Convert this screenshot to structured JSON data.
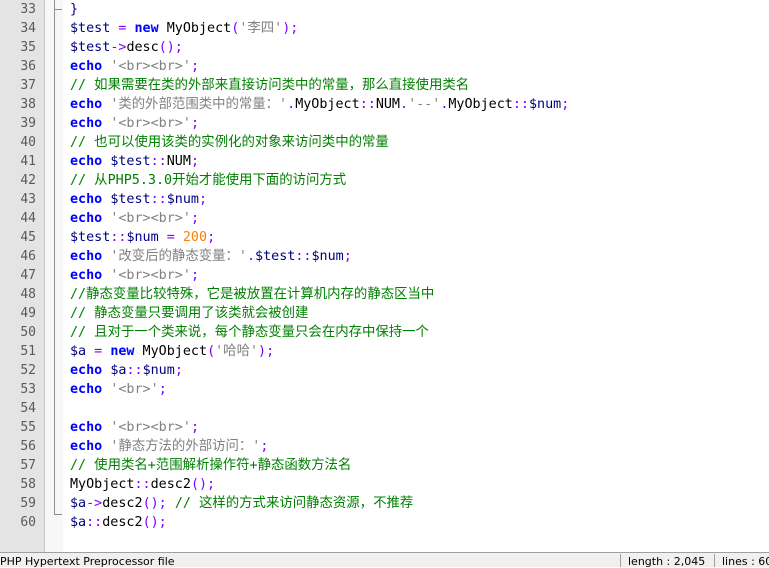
{
  "editor": {
    "lines": [
      {
        "num": "33",
        "tokens": [
          {
            "t": "fold",
            "v": "}"
          }
        ]
      },
      {
        "num": "34",
        "tokens": [
          {
            "t": "var",
            "v": "$test"
          },
          {
            "t": "op",
            "v": " = "
          },
          {
            "t": "keyword",
            "v": "new"
          },
          {
            "t": "plain",
            "v": " MyObject"
          },
          {
            "t": "op",
            "v": "("
          },
          {
            "t": "str",
            "v": "'李四'"
          },
          {
            "t": "op",
            "v": ");"
          }
        ]
      },
      {
        "num": "35",
        "tokens": [
          {
            "t": "var",
            "v": "$test"
          },
          {
            "t": "op",
            "v": "->"
          },
          {
            "t": "plain",
            "v": "desc"
          },
          {
            "t": "op",
            "v": "();"
          }
        ]
      },
      {
        "num": "36",
        "tokens": [
          {
            "t": "keyword",
            "v": "echo"
          },
          {
            "t": "plain",
            "v": " "
          },
          {
            "t": "str",
            "v": "'<br><br>'"
          },
          {
            "t": "op",
            "v": ";"
          }
        ]
      },
      {
        "num": "37",
        "tokens": [
          {
            "t": "comment",
            "v": "// 如果需要在类的外部来直接访问类中的常量，那么直接使用类名"
          }
        ]
      },
      {
        "num": "38",
        "tokens": [
          {
            "t": "keyword",
            "v": "echo"
          },
          {
            "t": "plain",
            "v": " "
          },
          {
            "t": "str",
            "v": "'类的外部范围类中的常量：'"
          },
          {
            "t": "op",
            "v": "."
          },
          {
            "t": "plain",
            "v": "MyObject"
          },
          {
            "t": "op",
            "v": "::"
          },
          {
            "t": "plain",
            "v": "NUM"
          },
          {
            "t": "op",
            "v": "."
          },
          {
            "t": "str",
            "v": "'--'"
          },
          {
            "t": "op",
            "v": "."
          },
          {
            "t": "plain",
            "v": "MyObject"
          },
          {
            "t": "op",
            "v": "::"
          },
          {
            "t": "var",
            "v": "$num"
          },
          {
            "t": "op",
            "v": ";"
          }
        ]
      },
      {
        "num": "39",
        "tokens": [
          {
            "t": "keyword",
            "v": "echo"
          },
          {
            "t": "plain",
            "v": " "
          },
          {
            "t": "str",
            "v": "'<br><br>'"
          },
          {
            "t": "op",
            "v": ";"
          }
        ]
      },
      {
        "num": "40",
        "tokens": [
          {
            "t": "comment",
            "v": "// 也可以使用该类的实例化的对象来访问类中的常量"
          }
        ]
      },
      {
        "num": "41",
        "tokens": [
          {
            "t": "keyword",
            "v": "echo"
          },
          {
            "t": "plain",
            "v": " "
          },
          {
            "t": "var",
            "v": "$test"
          },
          {
            "t": "op",
            "v": "::"
          },
          {
            "t": "plain",
            "v": "NUM"
          },
          {
            "t": "op",
            "v": ";"
          }
        ]
      },
      {
        "num": "42",
        "tokens": [
          {
            "t": "comment",
            "v": "// 从PHP5.3.0开始才能使用下面的访问方式"
          }
        ]
      },
      {
        "num": "43",
        "tokens": [
          {
            "t": "keyword",
            "v": "echo"
          },
          {
            "t": "plain",
            "v": " "
          },
          {
            "t": "var",
            "v": "$test"
          },
          {
            "t": "op",
            "v": "::"
          },
          {
            "t": "var",
            "v": "$num"
          },
          {
            "t": "op",
            "v": ";"
          }
        ]
      },
      {
        "num": "44",
        "tokens": [
          {
            "t": "keyword",
            "v": "echo"
          },
          {
            "t": "plain",
            "v": " "
          },
          {
            "t": "str",
            "v": "'<br><br>'"
          },
          {
            "t": "op",
            "v": ";"
          }
        ]
      },
      {
        "num": "45",
        "tokens": [
          {
            "t": "var",
            "v": "$test"
          },
          {
            "t": "op",
            "v": "::"
          },
          {
            "t": "var",
            "v": "$num"
          },
          {
            "t": "op",
            "v": " = "
          },
          {
            "t": "num",
            "v": "200"
          },
          {
            "t": "op",
            "v": ";"
          }
        ]
      },
      {
        "num": "46",
        "tokens": [
          {
            "t": "keyword",
            "v": "echo"
          },
          {
            "t": "plain",
            "v": " "
          },
          {
            "t": "str",
            "v": "'改变后的静态变量：'"
          },
          {
            "t": "op",
            "v": "."
          },
          {
            "t": "var",
            "v": "$test"
          },
          {
            "t": "op",
            "v": "::"
          },
          {
            "t": "var",
            "v": "$num"
          },
          {
            "t": "op",
            "v": ";"
          }
        ]
      },
      {
        "num": "47",
        "tokens": [
          {
            "t": "keyword",
            "v": "echo"
          },
          {
            "t": "plain",
            "v": " "
          },
          {
            "t": "str",
            "v": "'<br><br>'"
          },
          {
            "t": "op",
            "v": ";"
          }
        ]
      },
      {
        "num": "48",
        "tokens": [
          {
            "t": "comment",
            "v": "//静态变量比较特殊，它是被放置在计算机内存的静态区当中"
          }
        ]
      },
      {
        "num": "49",
        "tokens": [
          {
            "t": "comment",
            "v": "// 静态变量只要调用了该类就会被创建"
          }
        ]
      },
      {
        "num": "50",
        "tokens": [
          {
            "t": "comment",
            "v": "// 且对于一个类来说，每个静态变量只会在内存中保持一个"
          }
        ]
      },
      {
        "num": "51",
        "tokens": [
          {
            "t": "var",
            "v": "$a"
          },
          {
            "t": "op",
            "v": " = "
          },
          {
            "t": "keyword",
            "v": "new"
          },
          {
            "t": "plain",
            "v": " MyObject"
          },
          {
            "t": "op",
            "v": "("
          },
          {
            "t": "str",
            "v": "'哈哈'"
          },
          {
            "t": "op",
            "v": ");"
          }
        ]
      },
      {
        "num": "52",
        "tokens": [
          {
            "t": "keyword",
            "v": "echo"
          },
          {
            "t": "plain",
            "v": " "
          },
          {
            "t": "var",
            "v": "$a"
          },
          {
            "t": "op",
            "v": "::"
          },
          {
            "t": "var",
            "v": "$num"
          },
          {
            "t": "op",
            "v": ";"
          }
        ]
      },
      {
        "num": "53",
        "tokens": [
          {
            "t": "keyword",
            "v": "echo"
          },
          {
            "t": "plain",
            "v": " "
          },
          {
            "t": "str",
            "v": "'<br>'"
          },
          {
            "t": "op",
            "v": ";"
          }
        ]
      },
      {
        "num": "54",
        "tokens": []
      },
      {
        "num": "55",
        "tokens": [
          {
            "t": "keyword",
            "v": "echo"
          },
          {
            "t": "plain",
            "v": " "
          },
          {
            "t": "str",
            "v": "'<br><br>'"
          },
          {
            "t": "op",
            "v": ";"
          }
        ]
      },
      {
        "num": "56",
        "tokens": [
          {
            "t": "keyword",
            "v": "echo"
          },
          {
            "t": "plain",
            "v": " "
          },
          {
            "t": "str",
            "v": "'静态方法的外部访问：'"
          },
          {
            "t": "op",
            "v": ";"
          }
        ]
      },
      {
        "num": "57",
        "tokens": [
          {
            "t": "comment",
            "v": "// 使用类名+范围解析操作符+静态函数方法名"
          }
        ]
      },
      {
        "num": "58",
        "tokens": [
          {
            "t": "plain",
            "v": "MyObject"
          },
          {
            "t": "op",
            "v": "::"
          },
          {
            "t": "plain",
            "v": "desc2"
          },
          {
            "t": "op",
            "v": "();"
          }
        ]
      },
      {
        "num": "59",
        "tokens": [
          {
            "t": "var",
            "v": "$a"
          },
          {
            "t": "op",
            "v": "->"
          },
          {
            "t": "plain",
            "v": "desc2"
          },
          {
            "t": "op",
            "v": "(); "
          },
          {
            "t": "comment",
            "v": "// 这样的方式来访问静态资源，不推荐"
          }
        ]
      },
      {
        "num": "60",
        "tokens": [
          {
            "t": "var",
            "v": "$a"
          },
          {
            "t": "op",
            "v": "::"
          },
          {
            "t": "plain",
            "v": "desc2"
          },
          {
            "t": "op",
            "v": "();"
          }
        ]
      }
    ]
  },
  "statusbar": {
    "file_type": "PHP Hypertext Preprocessor file",
    "length": "length : 2,045",
    "lines": "lines : 60"
  }
}
